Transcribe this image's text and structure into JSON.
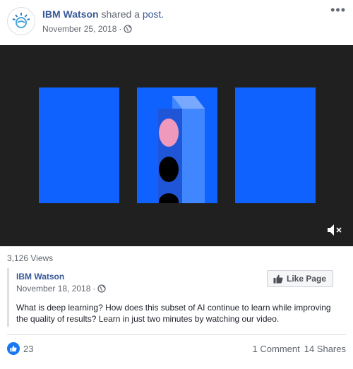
{
  "post": {
    "author": "IBM Watson",
    "action": "shared a",
    "action_link": "post.",
    "date": "November 25, 2018",
    "privacy_icon": "globe-icon",
    "more_label": "•••"
  },
  "video": {
    "icon": "mute-icon",
    "colors": {
      "background": "#202020",
      "panel": "#0f62fe",
      "light": "#ef99bd"
    }
  },
  "views": "3,126 Views",
  "shared_post": {
    "author": "IBM Watson",
    "date": "November 18, 2018",
    "like_page_label": "Like Page",
    "text": "What is deep learning? How does this subset of AI continue to learn while improving the quality of results? Learn in just two minutes by watching our video."
  },
  "footer": {
    "reaction_count": "23",
    "comments": "1 Comment",
    "shares": "14 Shares"
  },
  "colors": {
    "link": "#385898",
    "muted": "#616770",
    "like_blue": "#1877f2"
  }
}
